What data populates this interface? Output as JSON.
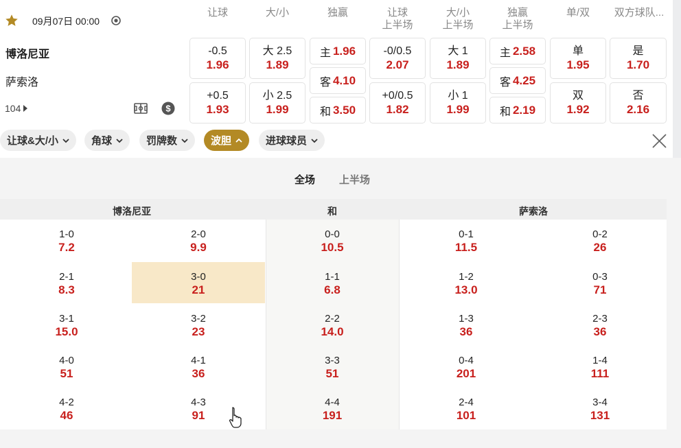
{
  "match": {
    "datetime": "09月07日 00:00",
    "home": "博洛尼亚",
    "away": "萨索洛",
    "more_count": "104"
  },
  "market_headers": [
    {
      "l1": "让球",
      "l2": ""
    },
    {
      "l1": "大/小",
      "l2": ""
    },
    {
      "l1": "独赢",
      "l2": ""
    },
    {
      "l1": "让球",
      "l2": "上半场"
    },
    {
      "l1": "大/小",
      "l2": "上半场"
    },
    {
      "l1": "独赢",
      "l2": "上半场"
    },
    {
      "l1": "单/双",
      "l2": ""
    },
    {
      "l1": "双方球队...",
      "l2": ""
    }
  ],
  "markets": {
    "handicap": [
      {
        "label": "-0.5",
        "odds": "1.96"
      },
      {
        "label": "+0.5",
        "odds": "1.93"
      }
    ],
    "overunder": [
      {
        "label": "大 2.5",
        "odds": "1.89"
      },
      {
        "label": "小 2.5",
        "odds": "1.99"
      }
    ],
    "winner": [
      {
        "label": "主",
        "odds": "1.96"
      },
      {
        "label": "客",
        "odds": "4.10"
      },
      {
        "label": "和",
        "odds": "3.50"
      }
    ],
    "handicap_1h": [
      {
        "label": "-0/0.5",
        "odds": "2.07"
      },
      {
        "label": "+0/0.5",
        "odds": "1.82"
      }
    ],
    "overunder_1h": [
      {
        "label": "大 1",
        "odds": "1.89"
      },
      {
        "label": "小 1",
        "odds": "1.99"
      }
    ],
    "winner_1h": [
      {
        "label": "主",
        "odds": "2.58"
      },
      {
        "label": "客",
        "odds": "4.25"
      },
      {
        "label": "和",
        "odds": "2.19"
      }
    ],
    "oddeven": [
      {
        "label": "单",
        "odds": "1.95"
      },
      {
        "label": "双",
        "odds": "1.92"
      }
    ],
    "btts": [
      {
        "label": "是",
        "odds": "1.70"
      },
      {
        "label": "否",
        "odds": "2.16"
      }
    ]
  },
  "filters": [
    {
      "label": "让球&大/小",
      "active": false
    },
    {
      "label": "角球",
      "active": false
    },
    {
      "label": "罚牌数",
      "active": false
    },
    {
      "label": "波胆",
      "active": true
    },
    {
      "label": "进球球员",
      "active": false
    }
  ],
  "tabs": [
    "全场",
    "上半场"
  ],
  "score_headers": {
    "home": "博洛尼亚",
    "draw": "和",
    "away": "萨索洛"
  },
  "correct_scores": [
    [
      {
        "s": "1-0",
        "o": "7.2"
      },
      {
        "s": "2-0",
        "o": "9.9"
      },
      {
        "s": "0-0",
        "o": "10.5"
      },
      {
        "s": "0-1",
        "o": "11.5"
      },
      {
        "s": "0-2",
        "o": "26"
      }
    ],
    [
      {
        "s": "2-1",
        "o": "8.3"
      },
      {
        "s": "3-0",
        "o": "21"
      },
      {
        "s": "1-1",
        "o": "6.8"
      },
      {
        "s": "1-2",
        "o": "13.0"
      },
      {
        "s": "0-3",
        "o": "71"
      }
    ],
    [
      {
        "s": "3-1",
        "o": "15.0"
      },
      {
        "s": "3-2",
        "o": "23"
      },
      {
        "s": "2-2",
        "o": "14.0"
      },
      {
        "s": "1-3",
        "o": "36"
      },
      {
        "s": "2-3",
        "o": "36"
      }
    ],
    [
      {
        "s": "4-0",
        "o": "51"
      },
      {
        "s": "4-1",
        "o": "36"
      },
      {
        "s": "3-3",
        "o": "51"
      },
      {
        "s": "0-4",
        "o": "201"
      },
      {
        "s": "1-4",
        "o": "111"
      }
    ],
    [
      {
        "s": "4-2",
        "o": "46"
      },
      {
        "s": "4-3",
        "o": "91"
      },
      {
        "s": "4-4",
        "o": "191"
      },
      {
        "s": "2-4",
        "o": "101"
      },
      {
        "s": "3-4",
        "o": "131"
      }
    ]
  ],
  "colors": {
    "accent": "#b38a25",
    "odds": "#c8201d",
    "highlight": "#f8e8c8"
  }
}
